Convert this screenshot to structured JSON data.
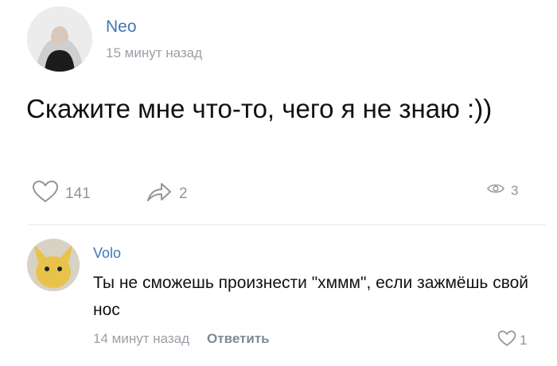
{
  "post": {
    "author": "Neo",
    "time": "15 минут назад",
    "text": "Скажите мне что-то, чего я не знаю :))",
    "likes": "141",
    "shares": "2",
    "views": "3"
  },
  "comment": {
    "author": "Volo",
    "text": "Ты не сможешь произнести \"хммм\", если зажмёшь свой нос",
    "time": "14 минут назад",
    "reply_label": "Ответить",
    "likes": "1"
  },
  "icons": {
    "like": "heart-icon",
    "share": "share-arrow-icon",
    "views": "eye-icon",
    "comment_like": "heart-icon"
  },
  "colors": {
    "author_link": "#3f78b5",
    "secondary_text": "#9aa0a6",
    "icon_gray": "#8e959c"
  }
}
